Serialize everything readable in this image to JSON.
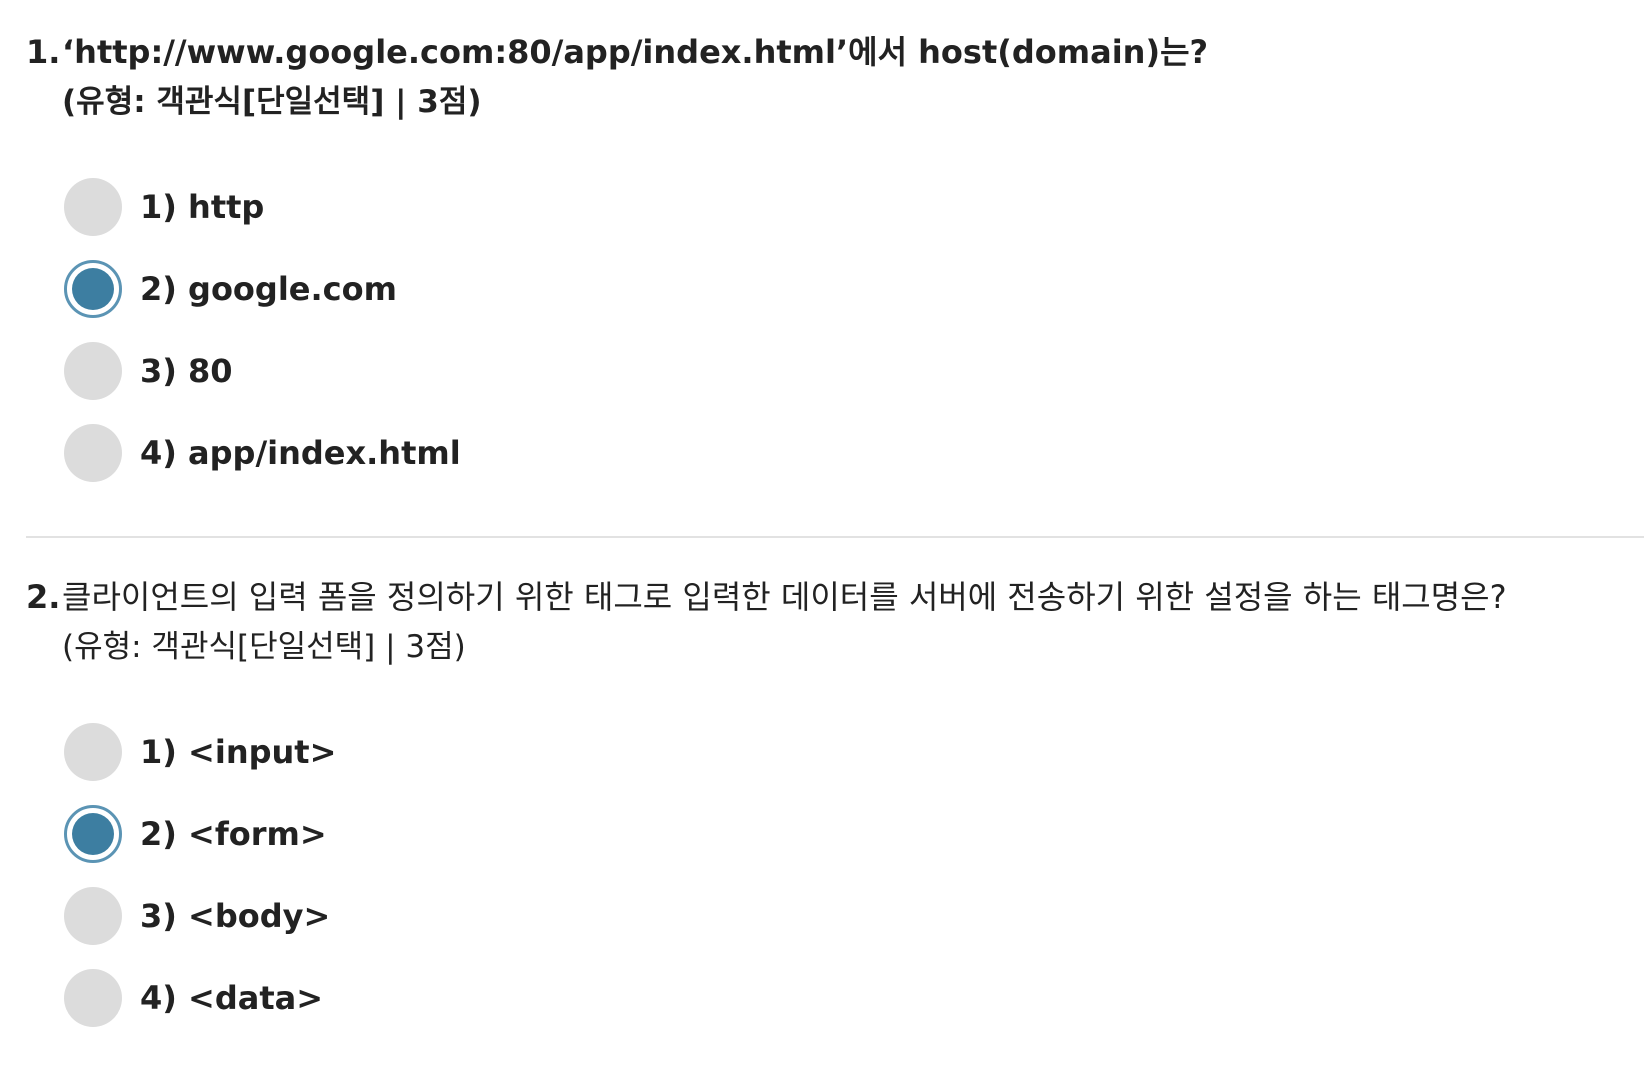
{
  "questions": [
    {
      "number": "1.",
      "text": "‘http://www.google.com:80/app/index.html’에서 host(domain)는?",
      "meta": "(유형: 객관식[단일선택] | 3점)",
      "options": [
        {
          "label": "1) http",
          "selected": false
        },
        {
          "label": "2) google.com",
          "selected": true
        },
        {
          "label": "3) 80",
          "selected": false
        },
        {
          "label": "4) app/index.html",
          "selected": false
        }
      ]
    },
    {
      "number": "2.",
      "text": "클라이언트의 입력 폼을 정의하기 위한 태그로 입력한 데이터를 서버에 전송하기 위한 설정을 하는 태그명은?",
      "meta": "(유형: 객관식[단일선택] | 3점)",
      "options": [
        {
          "label": "1) <input>",
          "selected": false
        },
        {
          "label": "2) <form>",
          "selected": true
        },
        {
          "label": "3) <body>",
          "selected": false
        },
        {
          "label": "4) <data>",
          "selected": false
        }
      ]
    }
  ],
  "colors": {
    "radio_unselected": "#dcdcdc",
    "radio_selected_fill": "#3d7ea1",
    "radio_selected_ring": "#5b94b4",
    "divider": "#e2e2e2"
  }
}
